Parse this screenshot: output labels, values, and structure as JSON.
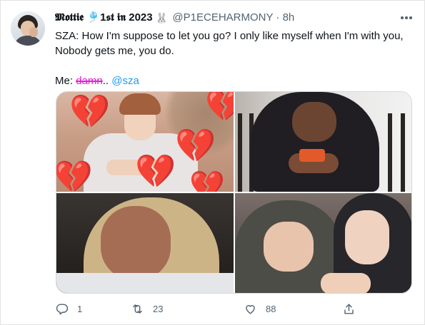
{
  "tweet": {
    "display_name": "𝕸𝖔𝖙𝖙𝖎𝖊 🎐1𝖘𝖙 𝖎𝖓 2023",
    "handle": "@P1ECEHARMONY",
    "separator": "·",
    "time": "8h",
    "line1": "SZA: How I'm suppose to let you go? I only like myself when I'm with you,",
    "line2": "Nobody gets me, you do.",
    "me_prefix": "Me: ",
    "strike_text": "damn",
    "after_strike": ".. ",
    "mention": "@sza"
  },
  "media": {
    "images": [
      {
        "description": "Person in white shirt with broken heart emojis"
      },
      {
        "description": "Man in black hoodie crying while looking at phone"
      },
      {
        "description": "Woman crying with blonde hair"
      },
      {
        "description": "Two people in hoodies embracing, one crying"
      }
    ]
  },
  "actions": {
    "reply_count": "1",
    "retweet_count": "23",
    "like_count": "88"
  },
  "colors": {
    "accent": "#1d9bf0",
    "strike": "#e01cd5",
    "muted": "#536471",
    "heart": "#e8232f"
  },
  "icons": [
    "rabbit-icon",
    "more-icon",
    "reply-icon",
    "retweet-icon",
    "like-icon",
    "share-icon",
    "broken-heart-icon"
  ]
}
